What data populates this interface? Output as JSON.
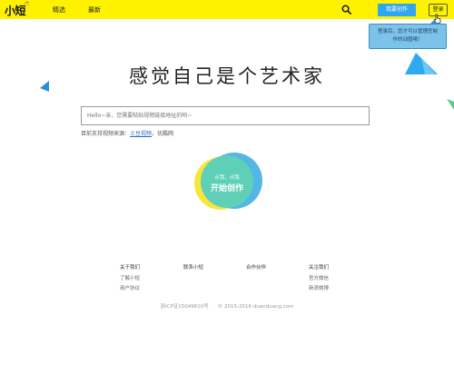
{
  "header": {
    "logo": "小短",
    "nav": [
      "精选",
      "最新"
    ],
    "create_label": "我要创作",
    "login_label": "登录"
  },
  "tooltip": {
    "line1": "登录后，您才可以管理您制",
    "line2": "作的动图哦！"
  },
  "main": {
    "slogan": "感觉自己是个艺术家",
    "input_placeholder": "Hello~亲，您需要粘贴视频链接地址的哟~",
    "source_prefix": "目前支持视频来源：",
    "source_link": "土豆视频",
    "source_suffix": "，优酷网",
    "start_sub": "点我，点我",
    "start_main": "开始创作"
  },
  "footer": {
    "col1": {
      "head": "关于我们",
      "links": [
        "了解小短",
        "用户协议"
      ]
    },
    "col2": {
      "head": "联系小短",
      "links": []
    },
    "col3": {
      "head": "合作伙伴",
      "links": []
    },
    "col4": {
      "head": "关注我们",
      "links": [
        "官方微信",
        "新浪微博"
      ]
    },
    "icp": "浙ICP证15049610号",
    "copyright": "© 2015-2016 duanduang.com"
  },
  "colors": {
    "brand_yellow": "#fef200",
    "accent_blue": "#2ea7f0",
    "start_green": "#5fcfb8",
    "start_blue": "#52b6e6",
    "start_yellow": "#f7e63a"
  }
}
